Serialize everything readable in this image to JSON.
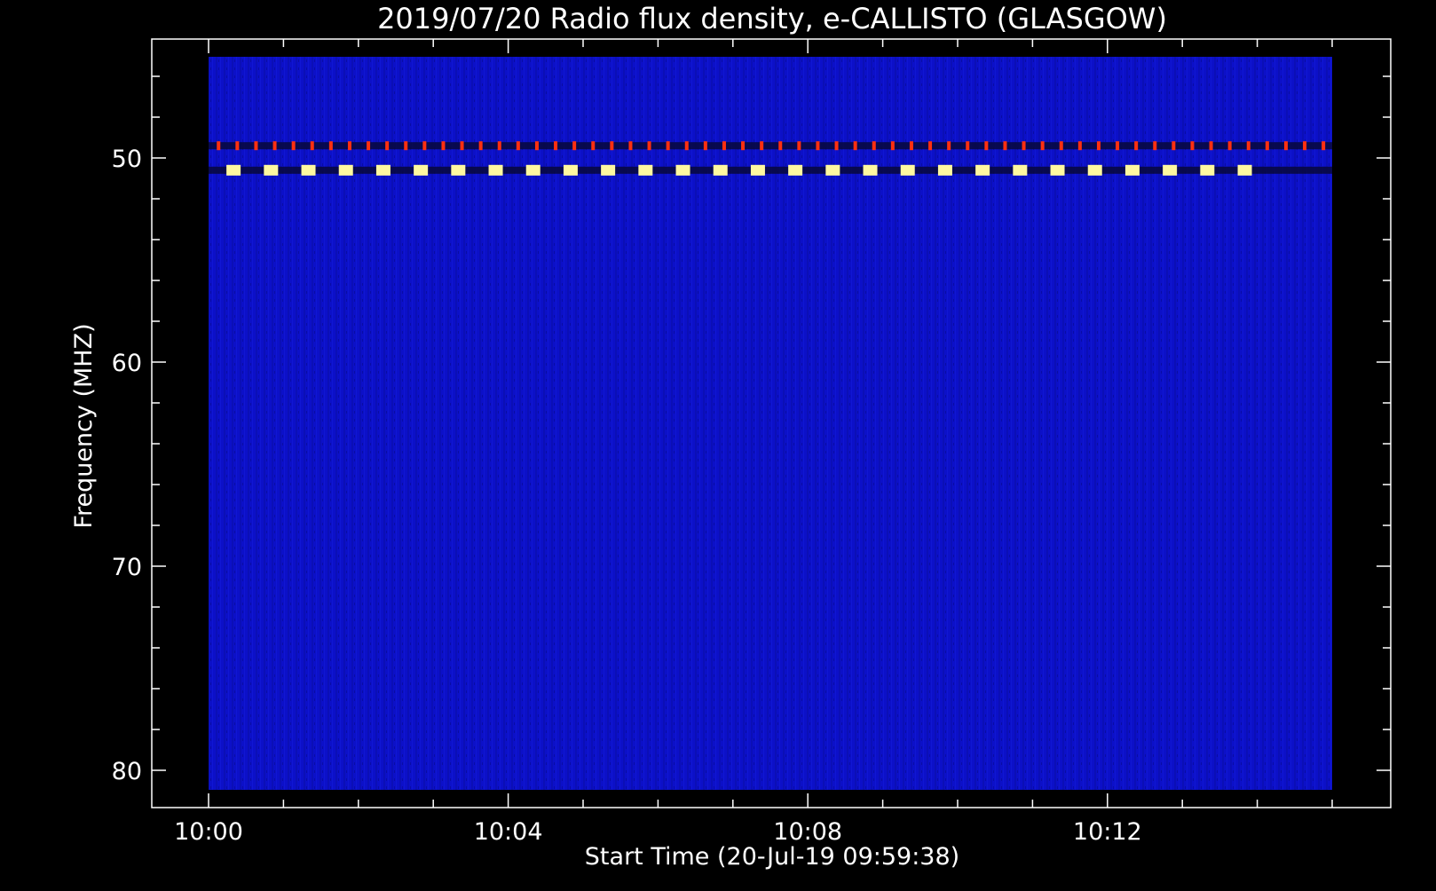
{
  "chart_data": {
    "type": "heatmap",
    "title": "2019/07/20  Radio flux density, e-CALLISTO (GLASGOW)",
    "xlabel": "Start Time (20-Jul-19 09:59:38)",
    "ylabel": "Frequency (MHZ)",
    "x_range": [
      "10:00",
      "10:15"
    ],
    "y_range": [
      45,
      81
    ],
    "y_inverted": true,
    "x_ticks": [
      "10:00",
      "10:04",
      "10:08",
      "10:12"
    ],
    "y_ticks": [
      50,
      60,
      70,
      80
    ],
    "background_color": "#000000",
    "colors": {
      "field": "#0c10c8",
      "interference_hot": "#fff8a0",
      "interference_warm": "#ff3010",
      "dark_band": "#08083a"
    },
    "features": [
      {
        "kind": "periodic_interference",
        "frequency_mhz": 50.6,
        "intensity": "high",
        "period_s": 30,
        "start": "10:00:20",
        "end": "10:14:00"
      },
      {
        "kind": "periodic_interference",
        "frequency_mhz": 49.4,
        "intensity": "medium",
        "period_s": 15,
        "start": "10:00:08",
        "end": "10:15:00"
      }
    ]
  }
}
